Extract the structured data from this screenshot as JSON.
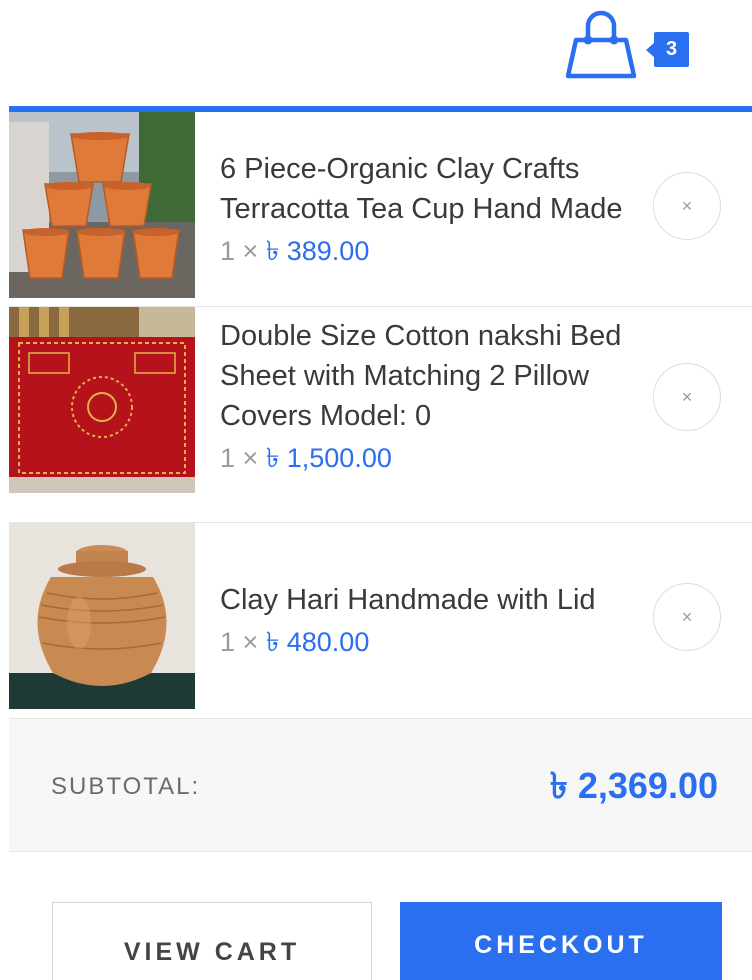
{
  "header": {
    "cart_icon": "shopping-bag-icon",
    "cart_count": "3"
  },
  "cart": {
    "items": [
      {
        "title": "6 Piece-Organic Clay Crafts Terracotta Tea Cup Hand Made",
        "qty": "1 ×",
        "price": "৳ 389.00",
        "remove": "×"
      },
      {
        "title": "Double Size Cotton nakshi Bed Sheet with Matching 2 Pillow Covers Model: 0",
        "qty": "1 ×",
        "price": "৳ 1,500.00",
        "remove": "×"
      },
      {
        "title": "Clay Hari Handmade with Lid",
        "qty": "1 ×",
        "price": "৳ 480.00",
        "remove": "×"
      }
    ],
    "subtotal_label": "SUBTOTAL:",
    "subtotal_value": "৳ 2,369.00",
    "view_cart_label": "VIEW CART",
    "checkout_label": "CHECKOUT"
  },
  "colors": {
    "accent": "#2a6ff0",
    "muted": "#9b9b9b",
    "border": "#e5e5e5"
  }
}
